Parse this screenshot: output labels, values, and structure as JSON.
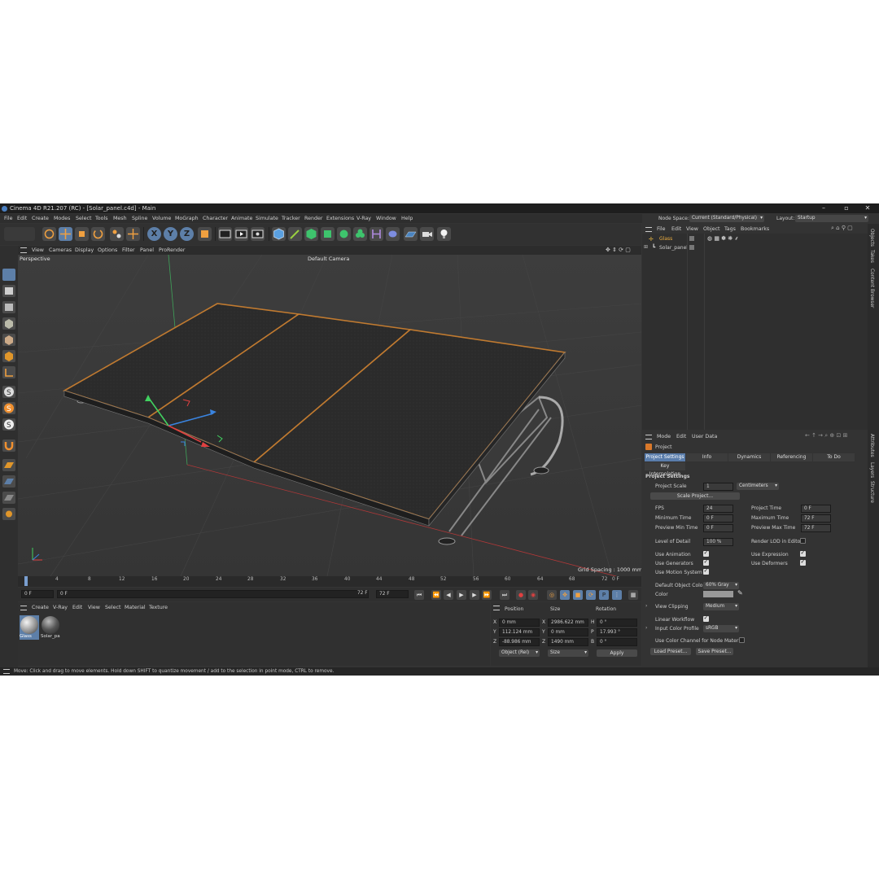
{
  "window": {
    "title": "Cinema 4D R21.207 (RC) - [Solar_panel.c4d] - Main"
  },
  "menu": [
    "File",
    "Edit",
    "Create",
    "Modes",
    "Select",
    "Tools",
    "Mesh",
    "Spline",
    "Volume",
    "MoGraph",
    "Character",
    "Animate",
    "Simulate",
    "Tracker",
    "Render",
    "Extensions",
    "V-Ray",
    "Window",
    "Help"
  ],
  "topright": {
    "node_space_label": "Node Space:",
    "node_space_value": "Current (Standard/Physical)",
    "layout_label": "Layout:",
    "layout_value": "Startup"
  },
  "viewport": {
    "menu": [
      "View",
      "Cameras",
      "Display",
      "Options",
      "Filter",
      "Panel",
      "ProRender"
    ],
    "projection": "Perspective",
    "camera": "Default Camera",
    "grid_spacing": "Grid Spacing : 1000 mm"
  },
  "timeline": {
    "ticks": [
      "0",
      "4",
      "8",
      "12",
      "16",
      "20",
      "24",
      "28",
      "32",
      "36",
      "40",
      "44",
      "48",
      "52",
      "56",
      "60",
      "64",
      "68",
      "72"
    ],
    "current_frame": "0 F"
  },
  "transport": {
    "start": "0 F",
    "range_start": "0 F",
    "range_end": "72 F",
    "end": "72 F"
  },
  "materials": {
    "menu": [
      "Create",
      "V-Ray",
      "Edit",
      "View",
      "Select",
      "Material",
      "Texture"
    ],
    "items": [
      {
        "name": "Glass"
      },
      {
        "name": "Solar_pa"
      }
    ]
  },
  "coords": {
    "headers": [
      "Position",
      "Size",
      "Rotation"
    ],
    "rows": [
      {
        "axis": "X",
        "pos": "0 mm",
        "size_axis": "X",
        "size": "2986.622 mm",
        "rot_axis": "H",
        "rot": "0 °"
      },
      {
        "axis": "Y",
        "pos": "112.124 mm",
        "size_axis": "Y",
        "size": "0 mm",
        "rot_axis": "P",
        "rot": "17.993 °"
      },
      {
        "axis": "Z",
        "pos": "-88.986 mm",
        "size_axis": "Z",
        "size": "1490 mm",
        "rot_axis": "B",
        "rot": "0 °"
      }
    ],
    "mode": "Object (Rel)",
    "size_mode": "Size",
    "apply": "Apply"
  },
  "objects": {
    "menu": [
      "File",
      "Edit",
      "View",
      "Object",
      "Tags",
      "Bookmarks"
    ],
    "items": [
      {
        "name": "Glass"
      },
      {
        "name": "Solar_panel"
      }
    ]
  },
  "attributes": {
    "menu": [
      "Mode",
      "Edit",
      "User Data"
    ],
    "title": "Project",
    "tabs": [
      "Project Settings",
      "Info",
      "Dynamics",
      "Referencing",
      "To Do"
    ],
    "tab2": "Key Interpolation",
    "section": "Project Settings",
    "project_scale_label": "Project Scale",
    "project_scale_value": "1",
    "project_scale_unit": "Centimeters",
    "scale_project_btn": "Scale Project...",
    "fps_label": "FPS",
    "fps": "24",
    "project_time_label": "Project Time",
    "project_time": "0 F",
    "min_time_label": "Minimum Time",
    "min_time": "0 F",
    "max_time_label": "Maximum Time",
    "max_time": "72 F",
    "prev_min_label": "Preview Min Time",
    "prev_min": "0 F",
    "prev_max_label": "Preview Max Time",
    "prev_max": "72 F",
    "lod_label": "Level of Detail",
    "lod": "100 %",
    "render_lod_label": "Render LOD in Editor",
    "use_animation": "Use Animation",
    "use_expression": "Use Expression",
    "use_generators": "Use Generators",
    "use_deformers": "Use Deformers",
    "use_motion": "Use Motion System",
    "default_color_label": "Default Object Color",
    "default_color": "60% Gray",
    "color_label": "Color",
    "view_clipping_label": "View Clipping",
    "view_clipping": "Medium",
    "linear_workflow": "Linear Workflow",
    "input_profile_label": "Input Color Profile",
    "input_profile": "sRGB",
    "color_channel_label": "Use Color Channel for Node Material",
    "load_preset": "Load Preset...",
    "save_preset": "Save Preset..."
  },
  "side_tabs_top": [
    "Objects",
    "Takes",
    "Content Browser"
  ],
  "side_tabs_bottom": [
    "Attributes",
    "Layers",
    "Structure"
  ],
  "status": "Move: Click and drag to move elements. Hold down SHIFT to quantize movement / add to the selection in point mode, CTRL to remove."
}
